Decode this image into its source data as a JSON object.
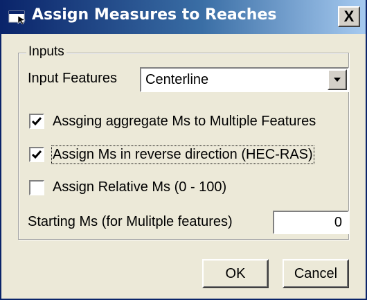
{
  "window": {
    "title": "Assign Measures to Reaches",
    "close_label": "X",
    "icon": "app-window-icon"
  },
  "inputs_group": {
    "label": "Inputs",
    "input_features_label": "Input Features",
    "input_features_value": "Centerline",
    "dropdown_icon": "chevron-down-icon"
  },
  "options": [
    {
      "label": "Assging aggregate Ms to Multiple Features",
      "checked": true
    },
    {
      "label": "Assign Ms in reverse direction (HEC-RAS)",
      "checked": true
    },
    {
      "label": "Assign Relative Ms (0 - 100)",
      "checked": false
    }
  ],
  "starting_ms": {
    "label": "Starting Ms (for Mulitple features)",
    "value": "0"
  },
  "buttons": {
    "ok_label": "OK",
    "cancel_label": "Cancel"
  },
  "colors": {
    "titlebar_start": "#0a246a",
    "titlebar_end": "#a6caf0",
    "face": "#ece9d8"
  }
}
